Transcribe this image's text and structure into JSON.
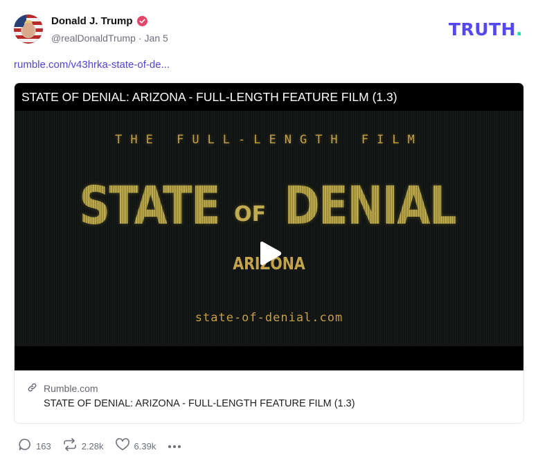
{
  "author": {
    "display_name": "Donald J. Trump",
    "handle": "@realDonaldTrump",
    "separator": "·",
    "date": "Jan 5",
    "verified_icon": "verified-badge-icon",
    "verified_color": "#e2476b"
  },
  "brand": {
    "name": "TRUTH",
    "dot": ".",
    "color": "#5448ee",
    "dot_color": "#17e2a5"
  },
  "post": {
    "link_text": "rumble.com/v43hrka-state-of-de..."
  },
  "video": {
    "title": "STATE OF DENIAL: ARIZONA - FULL-LENGTH FEATURE FILM (1.3)",
    "frame_subtitle": "THE FULL-LENGTH FILM",
    "frame_title_part1": "STATE",
    "frame_title_of": "OF",
    "frame_title_part2": "DENIAL",
    "frame_place": "ARIZONA",
    "frame_url": "state-of-denial.com",
    "play_icon": "play-icon"
  },
  "card": {
    "source": "Rumble.com",
    "source_icon": "link-icon",
    "title": "STATE OF DENIAL: ARIZONA - FULL-LENGTH FEATURE FILM (1.3)"
  },
  "actions": {
    "replies": "163",
    "reposts": "2.28k",
    "likes": "6.39k",
    "reply_icon": "reply-icon",
    "repost_icon": "repost-icon",
    "like_icon": "heart-icon",
    "more_icon": "more-dots-icon"
  },
  "colors": {
    "link": "#4f43d9",
    "muted_text": "#6b6f7a",
    "card_border": "#e8e8ee"
  }
}
